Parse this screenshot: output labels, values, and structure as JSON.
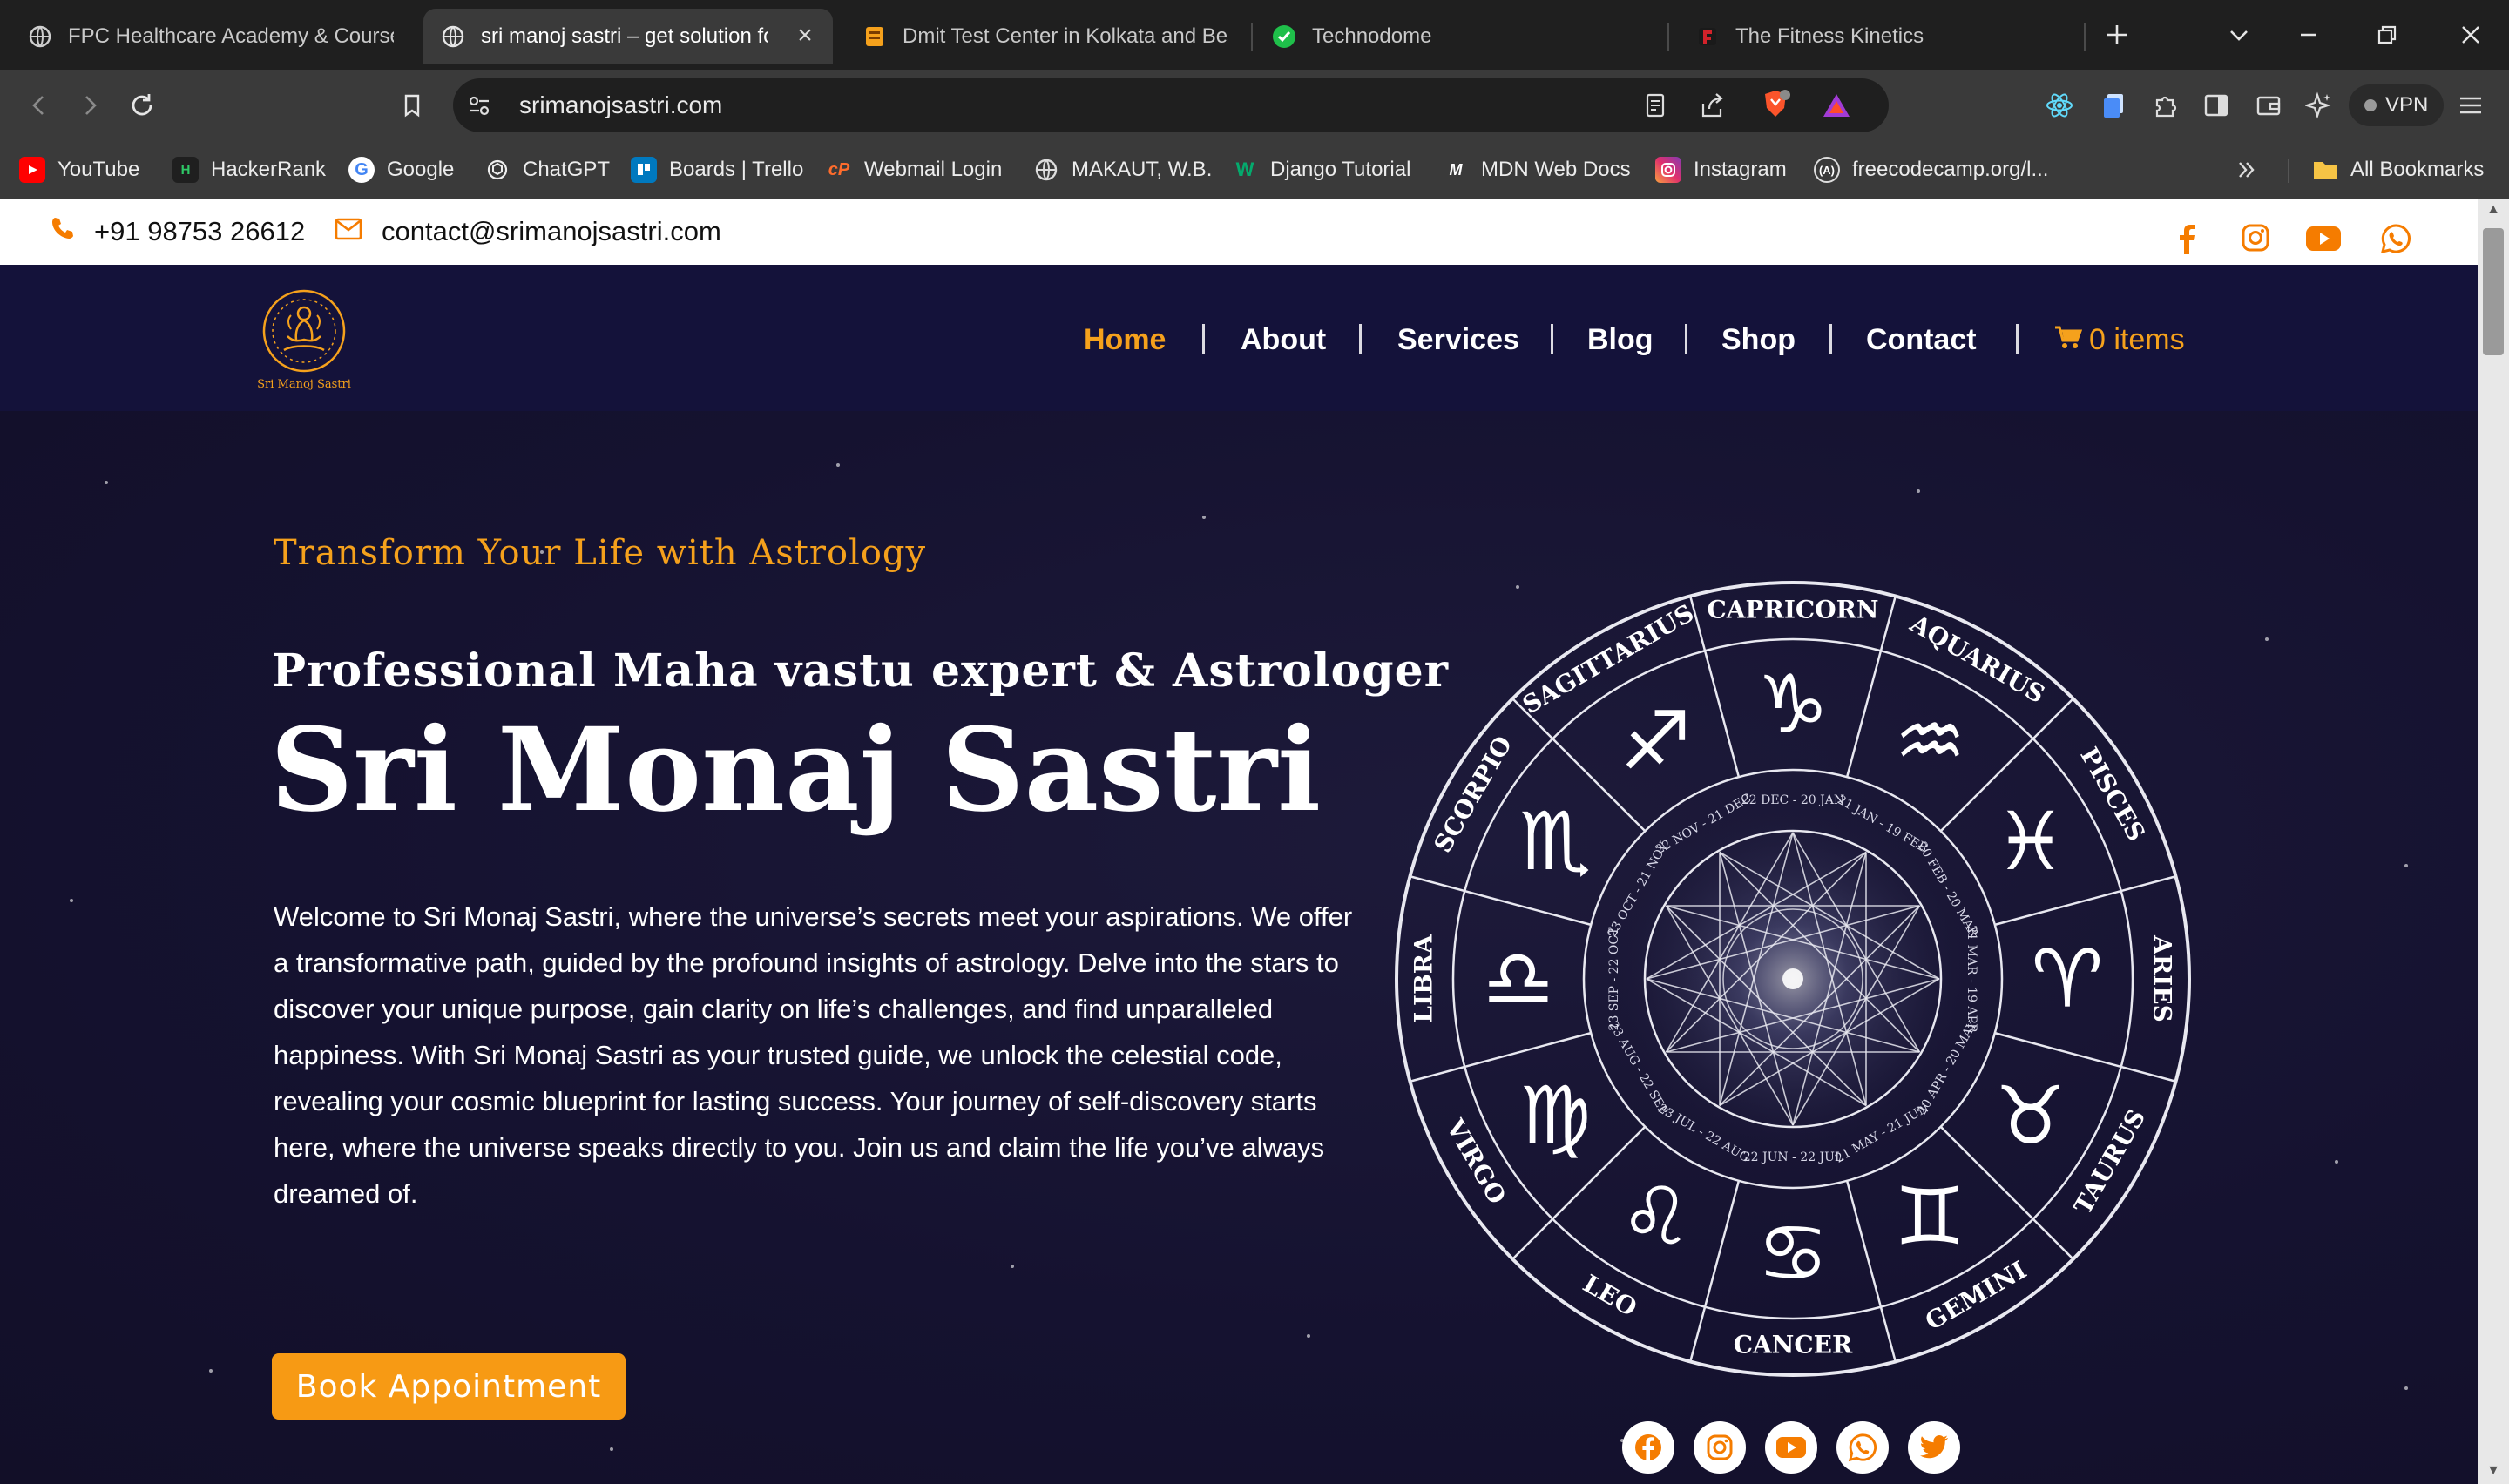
{
  "browser": {
    "tabs": [
      {
        "title": "FPC Healthcare Academy & Courses",
        "active": false
      },
      {
        "title": "sri manoj sastri – get solution fo",
        "active": true
      },
      {
        "title": "Dmit Test Center in Kolkata and Bes",
        "active": false
      },
      {
        "title": "Technodome",
        "active": false
      },
      {
        "title": "The Fitness Kinetics",
        "active": false
      }
    ],
    "url": "srimanojsastri.com",
    "vpn_label": "VPN",
    "bookmarks": [
      {
        "label": "YouTube",
        "icon": "youtube-icon"
      },
      {
        "label": "HackerRank",
        "icon": "hackerrank-icon"
      },
      {
        "label": "Google",
        "icon": "google-icon"
      },
      {
        "label": "ChatGPT",
        "icon": "chatgpt-icon"
      },
      {
        "label": "Boards | Trello",
        "icon": "trello-icon"
      },
      {
        "label": "Webmail Login",
        "icon": "cpanel-icon"
      },
      {
        "label": "MAKAUT, W.B.",
        "icon": "globe-icon"
      },
      {
        "label": "Django Tutorial",
        "icon": "w3schools-icon"
      },
      {
        "label": "MDN Web Docs",
        "icon": "mdn-icon"
      },
      {
        "label": "Instagram",
        "icon": "instagram-icon"
      },
      {
        "label": "freecodecamp.org/l...",
        "icon": "freecodecamp-icon"
      }
    ],
    "all_bookmarks_label": "All Bookmarks"
  },
  "site": {
    "topbar": {
      "phone": "+91 98753 26612",
      "email": "contact@srimanojsastri.com"
    },
    "logo_text": "Sri Manoj Sastri",
    "nav": [
      {
        "label": "Home",
        "active": true
      },
      {
        "label": "About",
        "active": false
      },
      {
        "label": "Services",
        "active": false
      },
      {
        "label": "Blog",
        "active": false
      },
      {
        "label": "Shop",
        "active": false
      },
      {
        "label": "Contact",
        "active": false
      }
    ],
    "cart_label": "0 items",
    "hero": {
      "tagline": "Transform Your Life with Astrology",
      "subtitle": "Professional Maha vastu expert & Astrologer",
      "title": "Sri Monaj Sastri",
      "body": "Welcome to Sri Monaj Sastri, where the universe’s secrets meet your aspirations. We offer a transformative path, guided by the profound insights of astrology. Delve into the stars to discover your unique purpose, gain clarity on life’s challenges, and find unparalleled happiness. With Sri Monaj Sastri as your trusted guide, we unlock the celestial code, revealing your cosmic blueprint for lasting success. Your journey of self-discovery starts here, where the universe speaks directly to you. Join us and claim the life you’ve always dreamed of.",
      "button": "Book Appointment"
    },
    "zodiac": [
      "CAPRICORN",
      "AQUARIUS",
      "PISCES",
      "ARIES",
      "TAURUS",
      "GEMINI",
      "CANCER",
      "LEO",
      "VIRGO",
      "LIBRA",
      "SCORPIO",
      "SAGITTARIUS"
    ],
    "zodiac_symbols": [
      "♑",
      "♒",
      "♓",
      "♈",
      "♉",
      "♊",
      "♋",
      "♌",
      "♍",
      "♎",
      "♏",
      "♐"
    ],
    "zodiac_dates": [
      "22 DEC - 20 JAN",
      "21 JAN - 19 FEB",
      "20 FEB - 20 MAR",
      "21 MAR - 19 APR",
      "20 APR - 20 MAY",
      "21 MAY - 21 JUN",
      "22 JUN - 22 JUL",
      "23 JUL - 22 AUG",
      "23 AUG - 22 SEP",
      "23 SEP - 22 OCT",
      "23 OCT - 21 NOV",
      "22 NOV - 21 DEC"
    ],
    "colors": {
      "accent": "#f79a14",
      "nav_bg": "#14123a",
      "hero_bg": "#151230"
    }
  }
}
